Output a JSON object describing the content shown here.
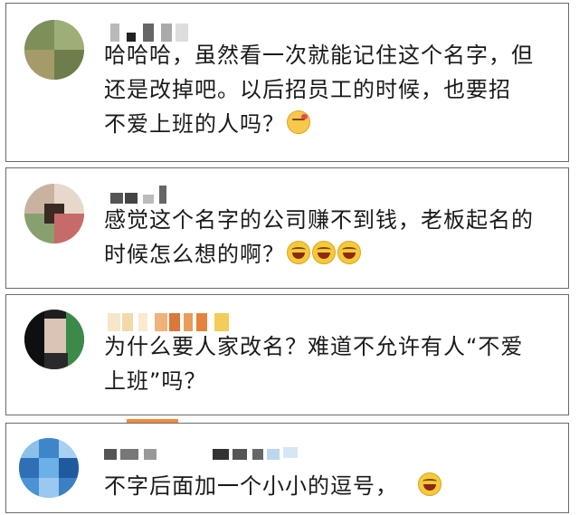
{
  "comments": [
    {
      "lines": [
        "哈哈哈，虽然看一次就能记住这个名字，但",
        "还是改掉吧。以后招员工的时候，也要招",
        "不爱上班的人吗？"
      ],
      "emoji": [
        "kiss"
      ]
    },
    {
      "lines": [
        "感觉这个名字的公司赚不到钱，老板起名的",
        "时候怎么想的啊？"
      ],
      "emoji": [
        "laugh",
        "laugh",
        "laugh"
      ]
    },
    {
      "lines": [
        "为什么要人家改名？难道不允许有人“不爱",
        "上班”吗？"
      ],
      "emoji": []
    },
    {
      "lines": [
        "不字后面加一个小小的逗号，"
      ],
      "emoji": [
        "laugh"
      ]
    }
  ],
  "colors": {
    "border": "#6a6a6a",
    "accent_bar": "#f28a3a"
  }
}
